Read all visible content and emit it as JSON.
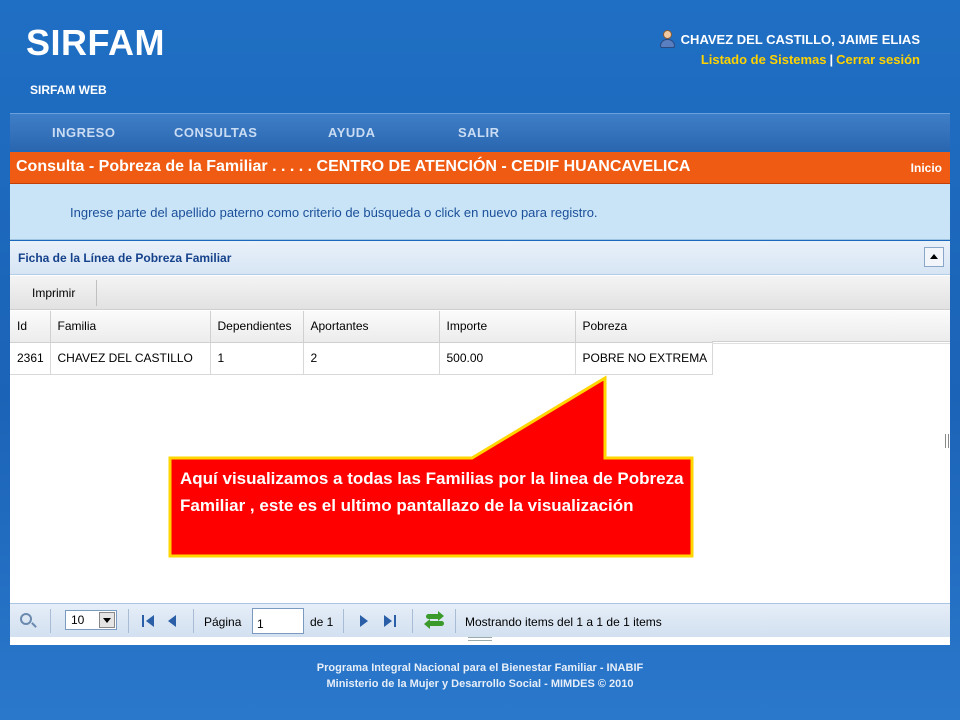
{
  "header": {
    "logo": "SIRFAM",
    "subtitle": "SIRFAM WEB",
    "user_name": "CHAVEZ DEL CASTILLO, JAIME ELIAS",
    "link_systems": "Listado de Sistemas",
    "link_separator": "|",
    "link_logout": "Cerrar sesión"
  },
  "nav": [
    "INGRESO",
    "CONSULTAS",
    "AYUDA",
    "SALIR"
  ],
  "titlebar": {
    "title": "Consulta - Pobreza de la Familiar . . . . . CENTRO DE ATENCIÓN - CEDIF HUANCAVELICA",
    "home": "Inicio"
  },
  "info": {
    "message": "Ingrese parte del apellido paterno como criterio de búsqueda o click en nuevo para registro."
  },
  "panel": {
    "title": "Ficha de la Línea de Pobreza Familiar",
    "toolbar_print": "Imprimir",
    "columns": [
      "Id",
      "Familia",
      "Dependientes",
      "Aportantes",
      "Importe",
      "Pobreza"
    ],
    "rows": [
      [
        "2361",
        "CHAVEZ DEL CASTILLO",
        "1",
        "2",
        "500.00",
        "POBRE NO EXTREMA"
      ]
    ]
  },
  "pager": {
    "page_size": "10",
    "page_label": "Página",
    "page_value": "1",
    "of_label": "de 1",
    "status": "Mostrando items del 1 a 1 de 1 items"
  },
  "callout": {
    "text": "Aquí visualizamos a todas las Familias por la linea de Pobreza Familiar , este es el ultimo pantallazo de la visualización",
    "fill": "#ff0000",
    "border": "#ffd600"
  },
  "footer": {
    "line1": "Programa Integral Nacional para el Bienestar Familiar - INABIF",
    "line2": "Ministerio de la Mujer y Desarrollo Social - MIMDES © 2010"
  }
}
